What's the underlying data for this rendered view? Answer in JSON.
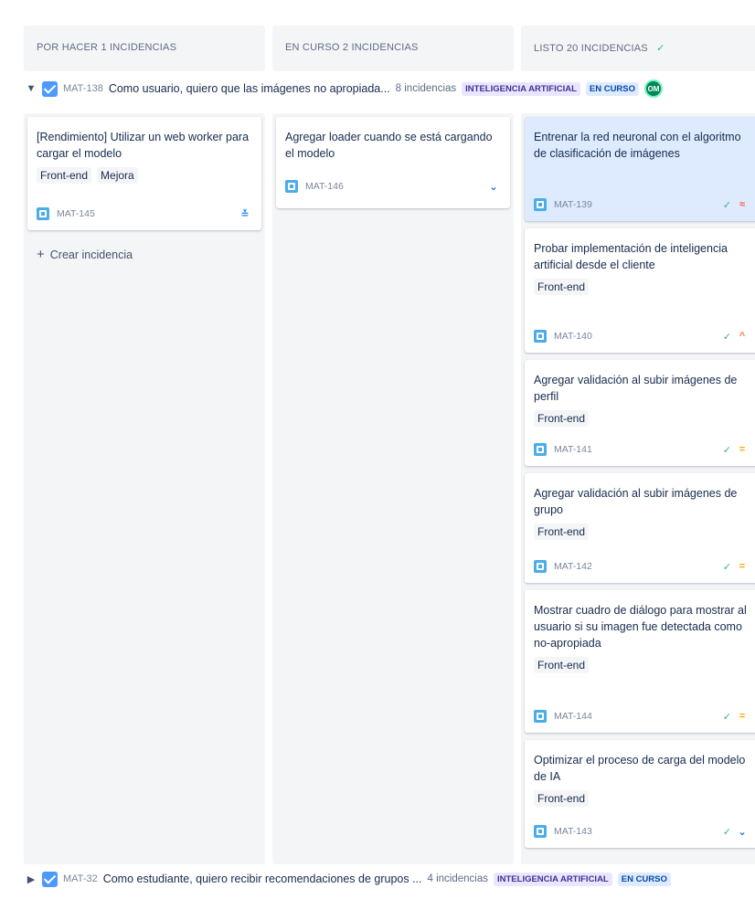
{
  "columns": [
    {
      "title": "POR HACER 1 INCIDENCIAS",
      "check": ""
    },
    {
      "title": "EN CURSO 2 INCIDENCIAS",
      "check": ""
    },
    {
      "title": "LISTO 20 INCIDENCIAS",
      "check": "✓"
    }
  ],
  "epics": [
    {
      "key": "MAT-138",
      "title": "Como usuario, quiero que las imágenes no apropiada...",
      "count": "8 incidencias",
      "label": "INTELIGENCIA ARTIFICIAL",
      "status": "EN CURSO",
      "avatar": "OM"
    },
    {
      "key": "MAT-32",
      "title": "Como estudiante, quiero recibir recomendaciones de grupos ...",
      "count": "4 incidencias",
      "label": "INTELIGENCIA ARTIFICIAL",
      "status": "EN CURSO"
    }
  ],
  "todo": [
    {
      "title": "[Rendimiento] Utilizar un web worker para cargar el modelo",
      "labels": [
        "Front-end",
        "Mejora"
      ],
      "key": "MAT-145",
      "priority": "lowest"
    }
  ],
  "in_progress": [
    {
      "title": "Agregar loader cuando se está cargando el modelo",
      "key": "MAT-146",
      "priority": "low"
    }
  ],
  "done": [
    {
      "title": "Entrenar la red neuronal con el algoritmo de clasificación de imágenes",
      "key": "MAT-139",
      "priority": "highest"
    },
    {
      "title": "Probar implementación de inteligencia artificial desde el cliente",
      "label": "Front-end",
      "key": "MAT-140",
      "priority": "high"
    },
    {
      "title": "Agregar validación al subir imágenes de perfil",
      "label": "Front-end",
      "key": "MAT-141",
      "priority": "medium"
    },
    {
      "title": "Agregar validación al subir imágenes de grupo",
      "label": "Front-end",
      "key": "MAT-142",
      "priority": "medium"
    },
    {
      "title": "Mostrar cuadro de diálogo para mostrar al usuario si su imagen fue detectada como no-apropiada",
      "label": "Front-end",
      "key": "MAT-144",
      "priority": "medium"
    },
    {
      "title": "Optimizar el proceso de carga del modelo de IA",
      "label": "Front-end",
      "key": "MAT-143",
      "priority": "low"
    }
  ],
  "create_label": "Crear incidencia",
  "icons": {
    "expanded": "chevron-down-icon",
    "collapsed": "chevron-right-icon",
    "done": "check-icon",
    "create": "plus-icon"
  },
  "colors": {
    "accent": "#4c9aff",
    "done_check": "#36b37e",
    "highlight": "#deebff"
  }
}
